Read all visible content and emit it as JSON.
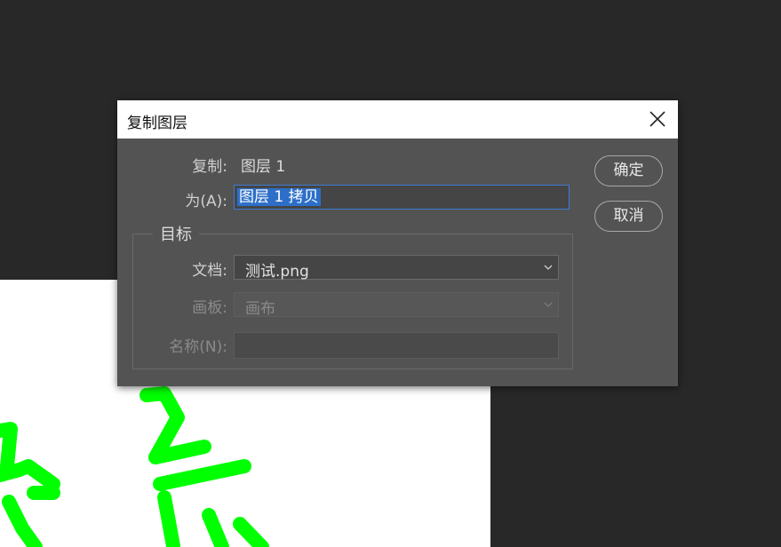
{
  "dialog": {
    "title": "复制图层",
    "copy_label": "复制:",
    "copy_value": "图层 1",
    "as_label": "为(A):",
    "as_value": "图层 1 拷贝",
    "ok_label": "确定",
    "cancel_label": "取消"
  },
  "target": {
    "legend": "目标",
    "document_label": "文档:",
    "document_value": "测试.png",
    "artboard_label": "画板:",
    "artboard_value": "画布",
    "name_label": "名称(N):",
    "name_value": ""
  },
  "colors": {
    "workspace": "#282828",
    "dialog_bg": "#535353",
    "selection": "#2d6fc8",
    "canvas_stroke": "#00ff00"
  },
  "icons": {
    "close": "close-icon",
    "dropdown": "chevron-down-icon"
  }
}
